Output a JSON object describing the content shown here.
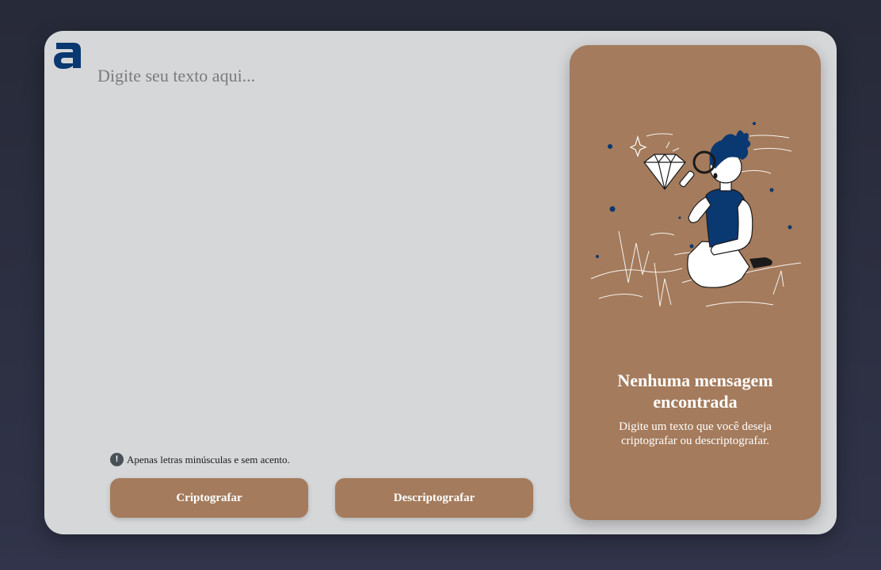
{
  "theme": {
    "accent": "#a47b5c",
    "brand_blue": "#0a3871",
    "card_background": "#d6d7d9",
    "page_background": "#2c2f41"
  },
  "brand": {
    "logo_icon": "alura-a-logo-icon"
  },
  "editor": {
    "placeholder": "Digite seu texto aqui...",
    "value": ""
  },
  "hint": {
    "icon": "exclamation-circle-icon",
    "text": "Apenas letras minúsculas e sem acento."
  },
  "actions": {
    "encrypt_label": "Criptografar",
    "decrypt_label": "Descriptografar"
  },
  "result": {
    "illustration": "person-magnifying-glass-diamond-illustration",
    "title": "Nenhuma mensagem encontrada",
    "message": "Digite um texto que você deseja criptografar ou descriptografar."
  }
}
